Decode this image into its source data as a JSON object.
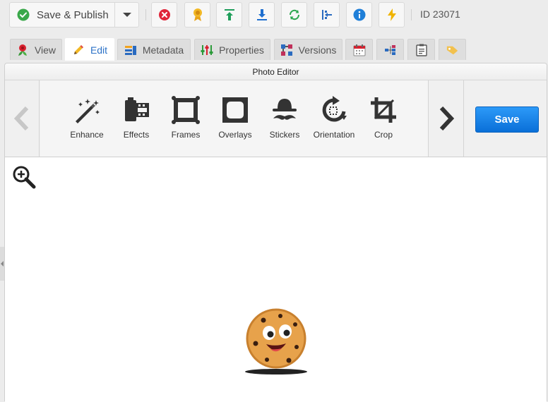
{
  "toolbar": {
    "save_publish_label": "Save & Publish",
    "document_id": "ID 23071"
  },
  "tabs": [
    {
      "label": "View",
      "icon": "flower-icon"
    },
    {
      "label": "Edit",
      "icon": "pencil-icon",
      "active": true
    },
    {
      "label": "Metadata",
      "icon": "metadata-icon"
    },
    {
      "label": "Properties",
      "icon": "properties-icon"
    },
    {
      "label": "Versions",
      "icon": "versions-icon"
    },
    {
      "label": "",
      "icon": "calendar-icon"
    },
    {
      "label": "",
      "icon": "tree-icon"
    },
    {
      "label": "",
      "icon": "clipboard-icon"
    },
    {
      "label": "",
      "icon": "tag-icon"
    }
  ],
  "editor": {
    "title": "Photo Editor",
    "tools": [
      "Enhance",
      "Effects",
      "Frames",
      "Overlays",
      "Stickers",
      "Orientation",
      "Crop"
    ],
    "save_label": "Save"
  },
  "colors": {
    "active_tab_text": "#2c72c7",
    "save_button": "#1585ea",
    "publish_check": "#3aa84a",
    "delete": "#e0263a",
    "info": "#1f7fd8",
    "green_action": "#1f9e5a"
  }
}
